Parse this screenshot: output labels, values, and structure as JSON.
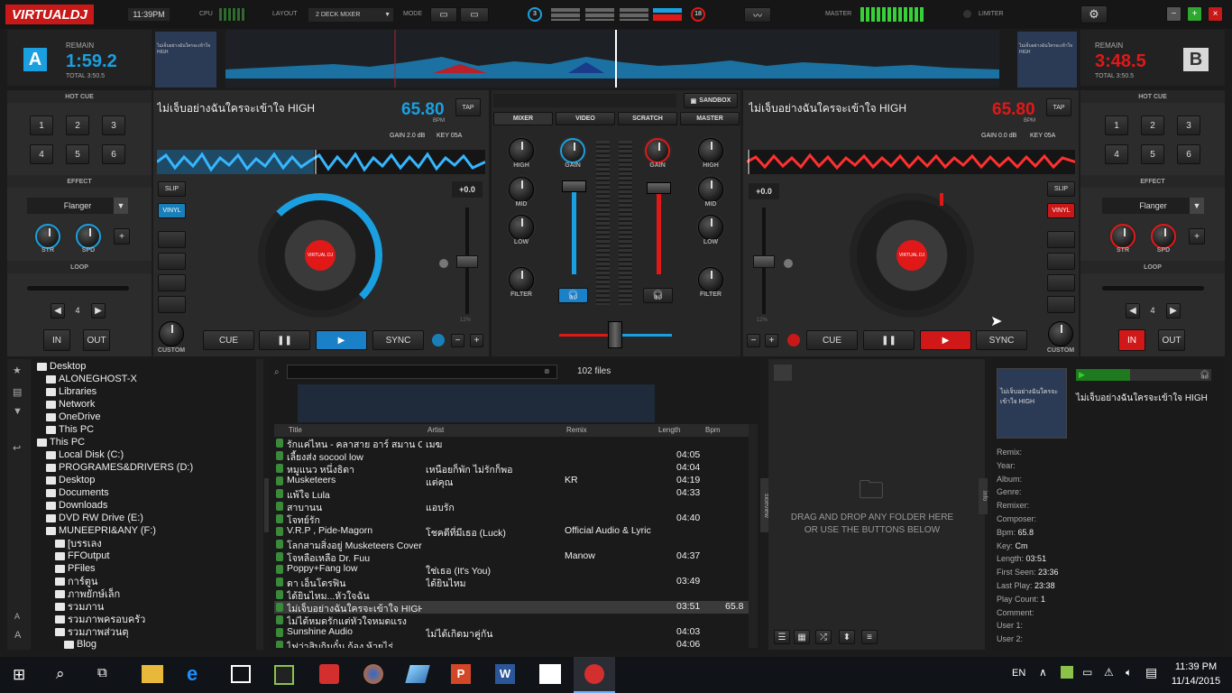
{
  "app": {
    "logo": "VIRTUALDJ",
    "clock": "11:39PM",
    "cpu_label": "CPU",
    "layout_label": "LAYOUT",
    "layout_value": "2 DECK MIXER",
    "mode_label": "MODE",
    "master_label": "MASTER",
    "limiter_label": "LIMITER",
    "deck_left_num": "3",
    "deck_right_num": "18"
  },
  "deckA": {
    "letter": "A",
    "remain_label": "REMAIN",
    "remain": "1:59.2",
    "total": "TOTAL 3:50.5",
    "title": "ไม่เจ็บอย่างฉันใครจะเข้าใจ HIGH",
    "bpm": "65.80",
    "bpm_label": "BPM",
    "tap": "TAP",
    "gain": "GAIN  2.0 dB",
    "key": "KEY  05A",
    "pitch": "+0.0",
    "pitch_range": "12%",
    "slip": "SLIP",
    "vinyl": "VINYL",
    "cue": "CUE",
    "sync": "SYNC",
    "custom": "CUSTOM",
    "accent": "#1aa0e0"
  },
  "deckB": {
    "letter": "B",
    "remain_label": "REMAIN",
    "remain": "3:48.5",
    "total": "TOTAL 3:50.5",
    "title": "ไม่เจ็บอย่างฉันใครจะเข้าใจ HIGH",
    "bpm": "65.80",
    "bpm_label": "BPM",
    "tap": "TAP",
    "gain": "GAIN  0.0 dB",
    "key": "KEY  05A",
    "pitch": "+0.0",
    "pitch_range": "12%",
    "slip": "SLIP",
    "vinyl": "VINYL",
    "cue": "CUE",
    "sync": "SYNC",
    "custom": "CUSTOM",
    "accent": "#e01818"
  },
  "side": {
    "hotcue": "HOT CUE",
    "cues": [
      "1",
      "2",
      "3",
      "4",
      "5",
      "6"
    ],
    "effect": "EFFECT",
    "effect_name": "Flanger",
    "str": "STR",
    "spd": "SPD",
    "loop": "LOOP",
    "loop_len": "4",
    "in": "IN",
    "out": "OUT"
  },
  "mixer": {
    "sandbox": "SANDBOX",
    "tabs": [
      "MIXER",
      "VIDEO",
      "SCRATCH",
      "MASTER"
    ],
    "high": "HIGH",
    "mid": "MID",
    "low": "LOW",
    "filter": "FILTER",
    "gain": "GAIN"
  },
  "tree": [
    {
      "label": "Desktop",
      "x": 0,
      "exp": "▪"
    },
    {
      "label": "ALONEGHOST-X",
      "x": 10,
      "exp": ""
    },
    {
      "label": "Libraries",
      "x": 10,
      "exp": ""
    },
    {
      "label": "Network",
      "x": 10,
      "exp": ""
    },
    {
      "label": "OneDrive",
      "x": 10,
      "exp": ""
    },
    {
      "label": "This PC",
      "x": 10,
      "exp": ""
    },
    {
      "label": "This PC",
      "x": 0,
      "exp": "▪"
    },
    {
      "label": "Local Disk (C:)",
      "x": 10,
      "exp": ""
    },
    {
      "label": "PROGRAMES&DRIVERS (D:)",
      "x": 10,
      "exp": ""
    },
    {
      "label": "Desktop",
      "x": 10,
      "exp": ""
    },
    {
      "label": "Documents",
      "x": 10,
      "exp": ""
    },
    {
      "label": "Downloads",
      "x": 10,
      "exp": ""
    },
    {
      "label": "DVD RW Drive (E:)",
      "x": 10,
      "exp": ""
    },
    {
      "label": "MUNEEPRI&ANY (F:)",
      "x": 10,
      "exp": ""
    },
    {
      "label": "[บรรเลง",
      "x": 20,
      "exp": ""
    },
    {
      "label": "FFOutput",
      "x": 20,
      "exp": ""
    },
    {
      "label": "PFiles",
      "x": 20,
      "exp": ""
    },
    {
      "label": "การ์ตูน",
      "x": 20,
      "exp": ""
    },
    {
      "label": "ภาพยักษ์เล็ก",
      "x": 20,
      "exp": ""
    },
    {
      "label": "รวมภาน",
      "x": 20,
      "exp": ""
    },
    {
      "label": "รวมภาพครอบครัว",
      "x": 20,
      "exp": ""
    },
    {
      "label": "รวมภาพส่วนตุ",
      "x": 20,
      "exp": ""
    },
    {
      "label": "Blog",
      "x": 30,
      "exp": ""
    }
  ],
  "browser": {
    "file_count": "102 files",
    "columns": [
      "Title",
      "Artist",
      "Remix",
      "Length",
      "Bpm"
    ],
    "rows": [
      {
        "title": "รักแค่ไหน - คลาสาย อาร์ สมาน Cover by Del Project...",
        "artist": "เมฆ",
        "remix": "",
        "length": "",
        "bpm": ""
      },
      {
        "title": "เลี้ยงส่ง socool low",
        "artist": "",
        "remix": "",
        "length": "04:05",
        "bpm": ""
      },
      {
        "title": "หมูแนว หนึ่งธิดา",
        "artist": "เหนือยก็พัก ไม่รักก็พอ",
        "remix": "",
        "length": "04:04",
        "bpm": ""
      },
      {
        "title": "Musketeers",
        "artist": "แต่คุณ",
        "remix": "KR",
        "length": "04:19",
        "bpm": ""
      },
      {
        "title": "แพ้ใจ   Lula",
        "artist": "",
        "remix": "",
        "length": "04:33",
        "bpm": ""
      },
      {
        "title": "สาบานน",
        "artist": "แอบรัก",
        "remix": "",
        "length": "",
        "bpm": ""
      },
      {
        "title": "โจทย์รัก",
        "artist": "",
        "remix": "",
        "length": "04:40",
        "bpm": ""
      },
      {
        "title": "V.R.P , Pide-Magorn",
        "artist": "โชคดีที่มีเธอ (Luck)",
        "remix": "Official Audio & Lyric",
        "length": "",
        "bpm": ""
      },
      {
        "title": "โลกสามสิ่งอยู่ Musketeers Cover by @iHearBa...",
        "artist": "",
        "remix": "",
        "length": "",
        "bpm": ""
      },
      {
        "title": "โจหลือเหลือ Dr. Fuu",
        "artist": "",
        "remix": "Manow",
        "length": "04:37",
        "bpm": ""
      },
      {
        "title": "Poppy+Fang low",
        "artist": "ใช่เธอ (It's You)",
        "remix": "",
        "length": "",
        "bpm": ""
      },
      {
        "title": "ดา เอ็นโดรฟิน",
        "artist": "ได้ยินไหม",
        "remix": "",
        "length": "03:49",
        "bpm": ""
      },
      {
        "title": "ได้ยินไหม...หัวใจฉัน",
        "artist": "",
        "remix": "",
        "length": "",
        "bpm": ""
      },
      {
        "title": "ไม่เจ็บอย่างฉันใครจะเข้าใจ HIGH",
        "artist": "",
        "remix": "",
        "length": "03:51",
        "bpm": "65.8"
      },
      {
        "title": "ไม่ได้หมดรักแต่หัวใจหมดแรง",
        "artist": "",
        "remix": "",
        "length": "",
        "bpm": ""
      },
      {
        "title": "Sunshine Audio",
        "artist": "ไม่ได้เกิดมาคู่กัน",
        "remix": "",
        "length": "04:03",
        "bpm": ""
      },
      {
        "title": "ไฟว่าสิบกิมกั๋น ก้อง ห้วยไร่",
        "artist": "",
        "remix": "",
        "length": "04:06",
        "bpm": ""
      }
    ]
  },
  "sidelist": {
    "folders_tab": "folders",
    "sideview_tab": "sideview",
    "drop_line1": "DRAG AND DROP ANY FOLDER HERE",
    "drop_line2": "OR USE THE BUTTONS BELOW",
    "info_tab": "info"
  },
  "info": {
    "cover_text": "ไม่เจ็บอย่างฉันใครจะเข้าใจ HIGH",
    "title": "ไม่เจ็บอย่างฉันใครจะเข้าใจ HIGH",
    "fields": [
      {
        "k": "Remix:",
        "v": ""
      },
      {
        "k": "Year:",
        "v": ""
      },
      {
        "k": "Album:",
        "v": ""
      },
      {
        "k": "Genre:",
        "v": ""
      },
      {
        "k": "Remixer:",
        "v": ""
      },
      {
        "k": "Composer:",
        "v": ""
      },
      {
        "k": "Bpm:",
        "v": "65.8"
      },
      {
        "k": "Key:",
        "v": "Cm"
      },
      {
        "k": "Length:",
        "v": "03:51"
      },
      {
        "k": "First Seen:",
        "v": "23:36"
      },
      {
        "k": "Last Play:",
        "v": "23:38"
      },
      {
        "k": "Play Count:",
        "v": "1"
      },
      {
        "k": "Comment:",
        "v": ""
      },
      {
        "k": "User 1:",
        "v": ""
      },
      {
        "k": "User 2:",
        "v": ""
      }
    ]
  },
  "taskbar": {
    "lang": "EN",
    "time": "11:39 PM",
    "date": "11/14/2015"
  }
}
